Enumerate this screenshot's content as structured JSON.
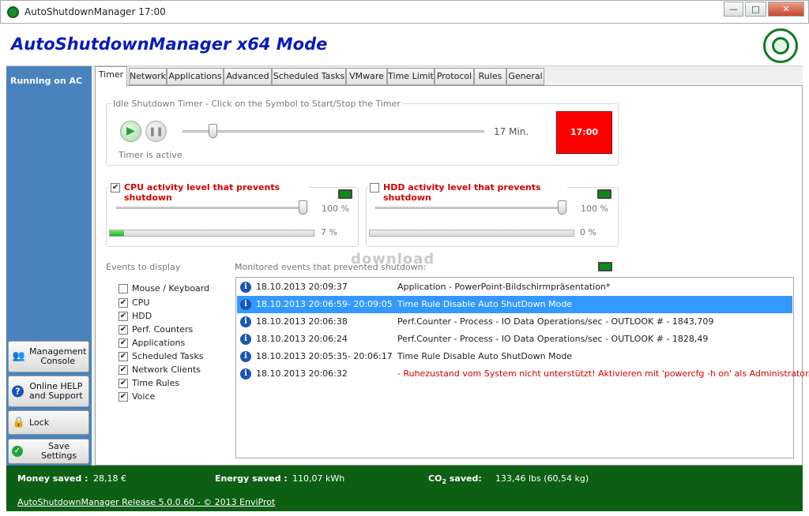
{
  "window": {
    "title": "AutoShutdownManager 17:00"
  },
  "header": {
    "app_title": "AutoShutdownManager x64 Mode"
  },
  "sidebar": {
    "status": "Running on AC",
    "buttons": [
      {
        "label1": "Management",
        "label2": "Console",
        "icon": "users-icon"
      },
      {
        "label1": "Online HELP",
        "label2": "and Support",
        "icon": "help-icon"
      },
      {
        "label1": "Lock",
        "label2": "",
        "icon": "lock-icon"
      },
      {
        "label1": "Save Settings",
        "label2": "",
        "icon": "check-icon"
      }
    ]
  },
  "tabs": [
    "Timer",
    "Network",
    "Applications",
    "Advanced",
    "Scheduled Tasks",
    "VMware",
    "Time Limit",
    "Protocol",
    "Rules",
    "General"
  ],
  "timer": {
    "group_label": "Idle Shutdown Timer - Click on the Symbol to Start/Stop the Timer",
    "value_label": "17 Min.",
    "slider_fraction": 0.09,
    "status": "Timer is active",
    "display_time": "17:00",
    "display_color": "#ff0000"
  },
  "cpu": {
    "checked": true,
    "label": "CPU  activity level that  prevents shutdown",
    "threshold_label": "100 %",
    "threshold_fraction": 1.0,
    "current_label": "7 %",
    "current_fraction": 0.07
  },
  "hdd": {
    "checked": false,
    "label": "HDD  activity level that  prevents shutdown",
    "threshold_label": "100 %",
    "threshold_fraction": 1.0,
    "current_label": "0 %",
    "current_fraction": 0.0
  },
  "events": {
    "label": "Events to display",
    "items": [
      {
        "label": "Mouse / Keyboard",
        "checked": false
      },
      {
        "label": "CPU",
        "checked": true
      },
      {
        "label": "HDD",
        "checked": true
      },
      {
        "label": "Perf. Counters",
        "checked": true
      },
      {
        "label": "Applications",
        "checked": true
      },
      {
        "label": "Scheduled Tasks",
        "checked": true
      },
      {
        "label": "Network Clients",
        "checked": true
      },
      {
        "label": "Time Rules",
        "checked": true
      },
      {
        "label": "Voice",
        "checked": true
      }
    ]
  },
  "monitored": {
    "label": "Monitored events that prevented shutdown:",
    "rows": [
      {
        "time": "18.10.2013 20:09:37",
        "message": "Application - PowerPoint-Bildschirmpräsentation*",
        "selected": false,
        "error": false
      },
      {
        "time": "18.10.2013 20:06:59- 20:09:05",
        "message": "Time Rule Disable Auto ShutDown Mode",
        "selected": true,
        "error": false
      },
      {
        "time": "18.10.2013 20:06:38",
        "message": "Perf.Counter - Process - IO Data Operations/sec - OUTLOOK # - 1843,709",
        "selected": false,
        "error": false
      },
      {
        "time": "18.10.2013 20:06:24",
        "message": "Perf.Counter - Process - IO Data Operations/sec - OUTLOOK # - 1828,49",
        "selected": false,
        "error": false
      },
      {
        "time": "18.10.2013 20:05:35- 20:06:17",
        "message": "Time Rule Disable Auto ShutDown Mode",
        "selected": false,
        "error": false
      },
      {
        "time": "18.10.2013 20:06:32",
        "message": " - Ruhezustand vom System nicht unterstützt! Aktivieren mit 'powercfg -h on' als Administrator.",
        "selected": false,
        "error": true
      }
    ]
  },
  "footer": {
    "money_label": "Money saved :",
    "money_value": "28,18 €",
    "energy_label": "Energy saved :",
    "energy_value": "110,07 kWh",
    "co2_label_prefix": "CO",
    "co2_label_sub": "2",
    "co2_label_suffix": "  saved:",
    "co2_value": "133,46 lbs  (60,54 kg)",
    "release_link": "AutoShutdownManager Release 5.0.0.60  - © 2013 EnviProt"
  },
  "watermark": "download",
  "colors": {
    "title_blue": "#0a1cb5",
    "sidebar_blue": "#4a82be",
    "footer_green": "#0d5f13",
    "selection": "#3399ff",
    "alert_red": "#d40000"
  }
}
